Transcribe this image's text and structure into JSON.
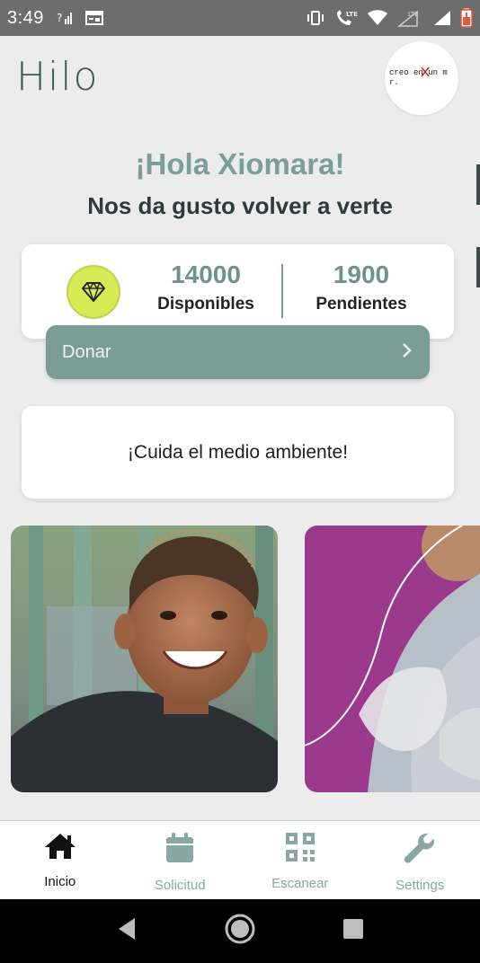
{
  "status_bar": {
    "time": "3:49",
    "right_icons": [
      "vibrate-icon",
      "volte-call-icon",
      "wifi-icon",
      "lte-signal-icon",
      "signal-icon",
      "battery-icon"
    ],
    "network_label": "LTE"
  },
  "header": {
    "logo": "Hilo",
    "avatar_text": "creo en un m\nr."
  },
  "greeting": "¡Hola Xiomara!",
  "subgreeting": "Nos da gusto volver a verte",
  "points": {
    "available_value": "14000",
    "available_label": "Disponibles",
    "pending_value": "1900",
    "pending_label": "Pendientes",
    "badge_icon": "diamond-icon"
  },
  "donate": {
    "label": "Donar"
  },
  "env_card": {
    "text": "¡Cuida el medio ambiente!"
  },
  "carousel": {
    "slides": [
      "smiling-boy-photo",
      "recycling-volunteer-photo"
    ]
  },
  "bottom_nav": {
    "items": [
      {
        "label": "Inicio",
        "icon": "home-icon",
        "active": true
      },
      {
        "label": "Solicitud",
        "icon": "calendar-icon",
        "active": false
      },
      {
        "label": "Escanear",
        "icon": "qr-code-icon",
        "active": false
      },
      {
        "label": "Settings",
        "icon": "wrench-icon",
        "active": false
      }
    ]
  },
  "colors": {
    "accent": "#7b9d97",
    "badge": "#d8ea55",
    "slide_purple": "#9b3a8c",
    "inactive_nav": "#8aa8a2"
  }
}
